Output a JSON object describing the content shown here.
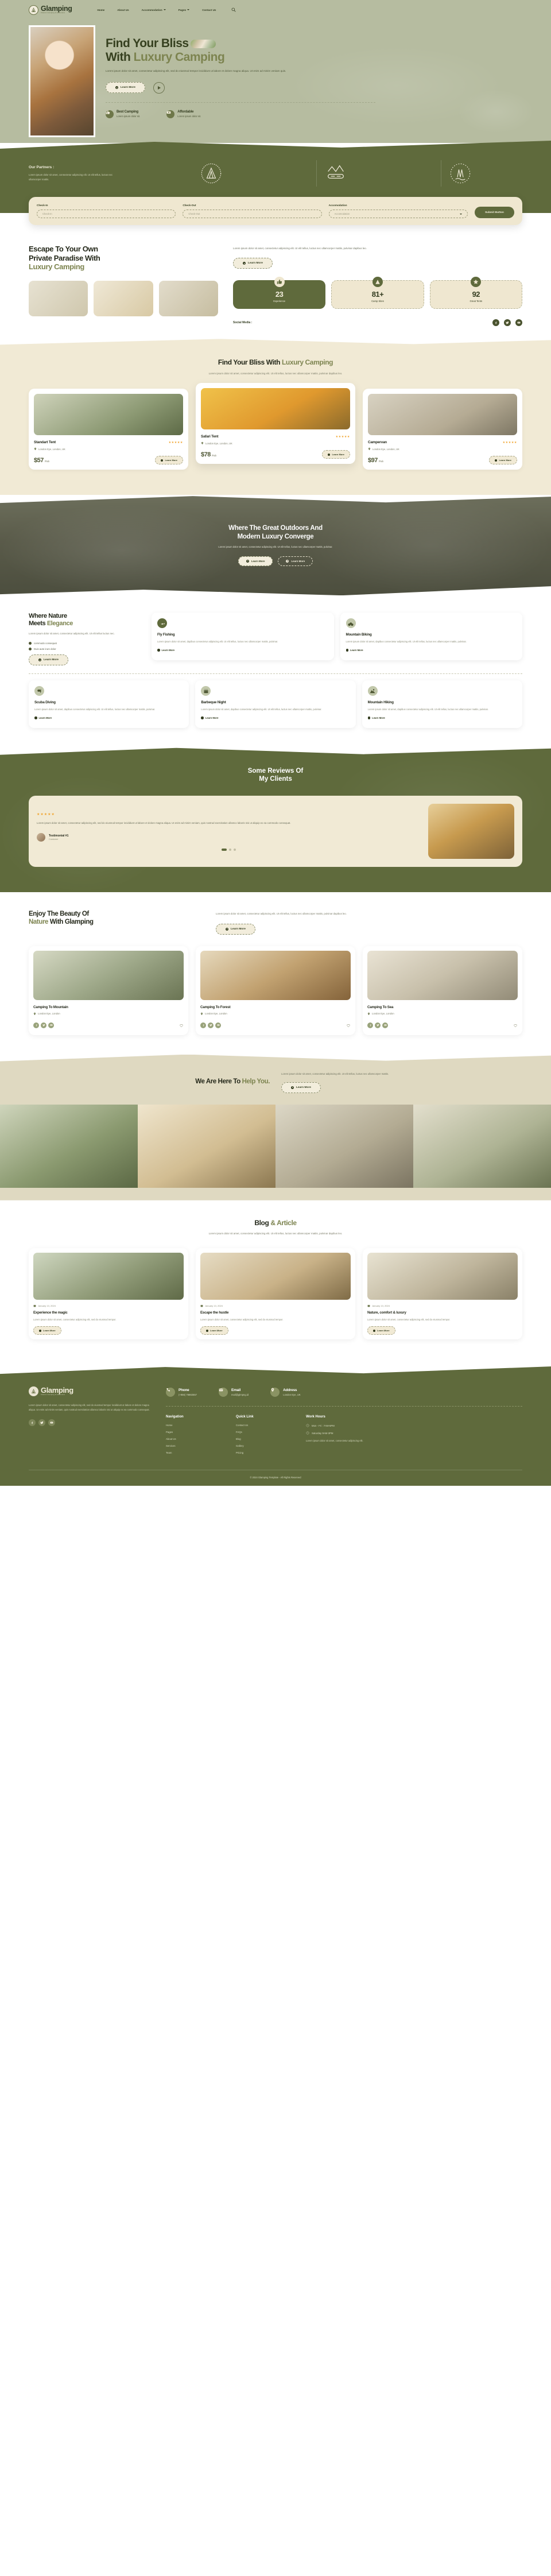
{
  "brand": {
    "name": "Glamping",
    "tagline": "Classic Camping & Adventure",
    "seal_icon": "tent-seal-icon"
  },
  "nav": {
    "items": [
      {
        "label": "Home",
        "dropdown": false
      },
      {
        "label": "About Us",
        "dropdown": false
      },
      {
        "label": "Accommodation",
        "dropdown": true
      },
      {
        "label": "Pages",
        "dropdown": true
      },
      {
        "label": "Contact Us",
        "dropdown": false
      }
    ],
    "search_icon": "search-icon"
  },
  "hero": {
    "title_line1": "Find Your Bliss",
    "title_line2_a": "With ",
    "title_line2_b": "Luxury Camping",
    "paragraph": "Lorem ipsum dolor sit amet, consectetur adipiscing elit, sed do eiusmod tempor incididunt ut labore et dolore magna aliqua. Ut enim ad minim veniam quis.",
    "cta": "Learn More",
    "play_label": "play-video",
    "features": [
      {
        "title": "Best Camping",
        "sub": "Lorem ipsum dolor sit.",
        "icon": "thumbs-up-icon"
      },
      {
        "title": "Affordable",
        "sub": "Lorem ipsum dolor sit.",
        "icon": "money-icon"
      }
    ]
  },
  "partners": {
    "heading": "Our Partners :",
    "text": "Lorem ipsum dolor sit amet, consectetur adipiscing elit. Ut elit tellus, luctus nec ullamcorper mattis.",
    "logos": [
      {
        "name": "WILD CAMPING",
        "icon": "wild-camping-logo"
      },
      {
        "name": "RAFTING",
        "icon": "rafting-logo"
      },
      {
        "name": "RIVER LIFE",
        "icon": "river-life-logo"
      }
    ]
  },
  "booking": {
    "fields": [
      {
        "label": "Check-In",
        "placeholder": "Check-In",
        "type": "date"
      },
      {
        "label": "Check-Out",
        "placeholder": "Check-Out",
        "type": "date"
      },
      {
        "label": "Accomodation",
        "placeholder": "Accomodation",
        "type": "select"
      }
    ],
    "submit": "Submit Button"
  },
  "escape": {
    "title_a": "Escape To Your Own",
    "title_b": "Private Paradise With",
    "title_c": "Luxury Camping",
    "paragraph": "Lorem ipsum dolor sit amet, consectetur adipiscing elit. Ut elit tellus, luctus nec ullamcorper mattis, pulvinar dapibus leo.",
    "cta": "Learn More",
    "stats": [
      {
        "value": "23",
        "label": "Experience",
        "icon": "thumbs-up-icon"
      },
      {
        "value": "81+",
        "label": "Camp Sites",
        "icon": "tent-icon"
      },
      {
        "value": "92",
        "label": "Great Tents",
        "icon": "star-icon"
      }
    ],
    "social_label": "Social Media :",
    "socials": [
      "facebook-icon",
      "twitter-icon",
      "youtube-icon"
    ]
  },
  "luxury": {
    "title_a": "Find Your Bliss With ",
    "title_b": "Luxury Camping",
    "paragraph": "Lorem ipsum dolor sit amet, consectetur adipiscing elit. Ut elit tellus, luctus nec ullamcorper mattis, pulvinar dapibus leo.",
    "cards": [
      {
        "name": "Standart Tent",
        "stars": "★★★★★",
        "location": "London Eye, London, UK",
        "price": "$57",
        "unit": "/Pack",
        "cta": "Learn More"
      },
      {
        "name": "Safari Tent",
        "stars": "★★★★★",
        "location": "London Eye, London, UK",
        "price": "$78",
        "unit": "/Pack",
        "cta": "Learn More"
      },
      {
        "name": "Campervan",
        "stars": "★★★★★",
        "location": "London Eye, London, UK",
        "price": "$97",
        "unit": "/Pack",
        "cta": "Learn More"
      }
    ]
  },
  "converge": {
    "title_a": "Where The Great Outdoors And",
    "title_b": "Modern Luxury Converge",
    "paragraph": "Lorem ipsum dolor sit amet, consectetur adipiscing elit. Ut elit tellus, luctus nec ullamcorper mattis, pulvinar.",
    "cta_primary": "Learn More",
    "cta_secondary": "Learn More"
  },
  "activities": {
    "title_a": "Where Nature",
    "title_b": "Meets ",
    "title_c": "Elegance",
    "paragraph": "Lorem ipsum dolor sit amet, consectetur adipiscing elit. Ut elit tellus luctus nec.",
    "ticks": [
      "commodo consequat",
      "Duis aute irure dolor"
    ],
    "cta": "Learn More",
    "body": "Lorem ipsum dolor sit amet, dapibus consectetur adipiscing elit. Ut elit tellus, luctus nec ullamcorper mattis, pulvinar.",
    "link": "Learn More",
    "row1": [
      {
        "title": "Fly Fishing",
        "icon": "fishing-icon",
        "tone": "dark"
      },
      {
        "title": "Mountain Biking",
        "icon": "bicycle-icon",
        "tone": "lite"
      }
    ],
    "row2": [
      {
        "title": "Scuba Diving",
        "icon": "snorkel-icon",
        "tone": "lite"
      },
      {
        "title": "Barbeque Night",
        "icon": "bbq-icon",
        "tone": "lite"
      },
      {
        "title": "Mountain Hiking",
        "icon": "mountain-icon",
        "tone": "lite"
      }
    ]
  },
  "reviews": {
    "title_a": "Some Reviews Of",
    "title_b": "My Clients",
    "stars": "★★★★★",
    "quote": "Lorem ipsum dolor sit amet, consectetur adipiscing elit, sed do eiusmod tempor incididunt ut labore et dolore magna aliqua. Ut enim ad minim veniam, quis nostrud exercitation ullamco laboris nisi ut aliquip ex ea commodo consequat.",
    "author": "Testimonial #1",
    "role": "Customer"
  },
  "enjoy": {
    "title_a": "Enjoy The Beauty Of",
    "title_b": "Nature ",
    "title_c": "With Glamping",
    "paragraph": "Lorem ipsum dolor sit amet, consectetur adipiscing elit. Ut elit tellus, luctus nec ullamcorper mattis, pulvinar dapibus leo.",
    "cta": "Learn More",
    "cards": [
      {
        "title": "Camping To Mountain",
        "location": "London Eye, London"
      },
      {
        "title": "Camping To Forest",
        "location": "London Eye, London"
      },
      {
        "title": "Camping To Sea",
        "location": "London Eye, London"
      }
    ]
  },
  "help": {
    "title_a": "We Are Here To",
    "title_b": "Help You.",
    "paragraph": "Lorem ipsum dolor sit amet, consectetur adipiscing elit. Ut elit tellus, luctus nec ullamcorper mattis.",
    "cta": "Learn More"
  },
  "blog": {
    "title_a": "Blog ",
    "title_b": "& Article",
    "paragraph": "Lorem ipsum dolor sit amet, consectetur adipiscing elit. Ut elit tellus, luctus nec ullamcorper mattis, pulvinar dapibus leo.",
    "posts": [
      {
        "date": "January 13, 2024",
        "title": "Experience the magic",
        "excerpt": "Lorem ipsum dolor sit amet, consectetur adipiscing elit, sed do eiusmod tempor.",
        "cta": "Learn More"
      },
      {
        "date": "January 13, 2024",
        "title": "Escape the hustle",
        "excerpt": "Lorem ipsum dolor sit amet, consectetur adipiscing elit, sed do eiusmod tempor.",
        "cta": "Learn More"
      },
      {
        "date": "January 13, 2024",
        "title": "Nature, comfort & luxury",
        "excerpt": "Lorem ipsum dolor sit amet, consectetur adipiscing elit, sed do eiusmod tempor.",
        "cta": "Learn More"
      }
    ]
  },
  "footer": {
    "about": "Lorem ipsum dolor sit amet, consectetur adipiscing elit, sed do eiusmod tempor incididunt ut labore et dolore magna aliqua. Ut enim ad minim veniam, quis nostrud exercitation ullamco laboris nisi ut aliquip ex ea commodo consequat.",
    "socials": [
      "facebook-icon",
      "twitter-icon",
      "youtube-icon"
    ],
    "contacts": [
      {
        "label": "Phone",
        "value": "(+856) 76882557",
        "icon": "phone-icon"
      },
      {
        "label": "Email",
        "value": "mail@glmpng.id",
        "icon": "email-icon"
      },
      {
        "label": "Address",
        "value": "London Eye, UK",
        "icon": "location-icon"
      }
    ],
    "nav_heading": "Navigation",
    "nav_links": [
      "Home",
      "Pages",
      "About Us",
      "Services",
      "Team"
    ],
    "quick_heading": "Quick Link",
    "quick_links": [
      "Contact Us",
      "FAQs",
      "Blog",
      "Gallery",
      "Pricing"
    ],
    "hours_heading": "Work Hours",
    "hours": [
      "Mon - Fri : 7AM-5PM",
      "Saturday 9AM-3PM"
    ],
    "hours_note": "Lorem ipsum dolor sit amet, consectetur adipiscing elit.",
    "copyright": "© 2024 Glamping Template - All Rights Reserved"
  },
  "colors": {
    "brand_green": "#5f6a3c",
    "sage": "#b6bca0",
    "cream": "#f1ead5",
    "star": "#f0a32c"
  }
}
